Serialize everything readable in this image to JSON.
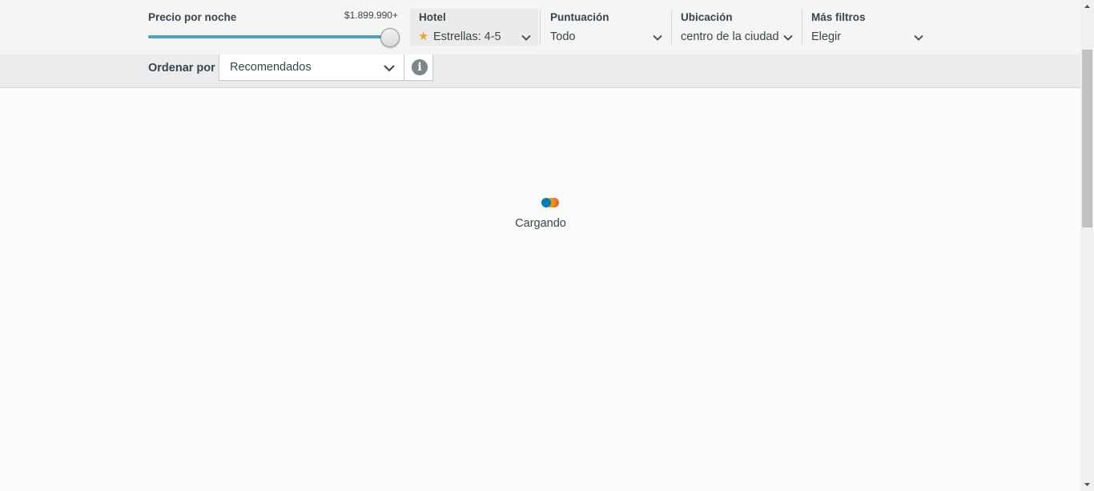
{
  "filters": {
    "price": {
      "label": "Precio por noche",
      "value": "$1.899.990+",
      "slider_fraction": 1.0
    },
    "hotel": {
      "label": "Hotel",
      "value": "Estrellas: 4-5",
      "icon": "star-icon",
      "icon_color": "#f4a51c"
    },
    "rating": {
      "label": "Puntuación",
      "value": "Todo"
    },
    "location": {
      "label": "Ubicación",
      "value": "centro de la ciudad"
    },
    "more": {
      "label": "Más filtros",
      "value": "Elegir"
    }
  },
  "sort": {
    "label": "Ordenar por",
    "value": "Recomendados",
    "info_icon": "info-icon"
  },
  "loading": {
    "text": "Cargando",
    "colors": [
      "#007faf",
      "#f48f00",
      "#e8663c"
    ]
  },
  "colors": {
    "slider_fill": "#4aa3c0",
    "star": "#f4a51c"
  }
}
